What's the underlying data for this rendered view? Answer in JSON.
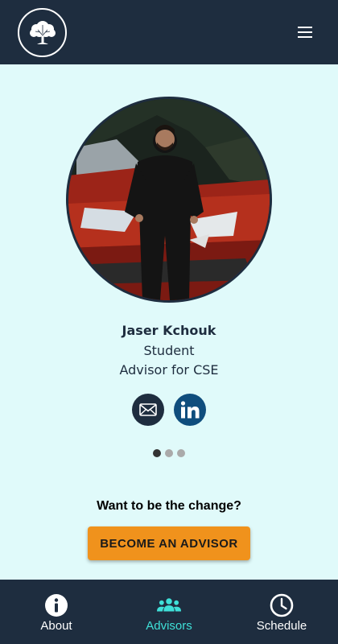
{
  "header": {
    "logo_icon": "tree-logo-icon",
    "menu_icon": "hamburger-menu-icon"
  },
  "advisor": {
    "name": "Jaser Kchouk",
    "role_line1": "Student",
    "role_line2": "Advisor for CSE",
    "social": [
      {
        "icon": "mail-icon"
      },
      {
        "icon": "linkedin-icon"
      }
    ]
  },
  "carousel": {
    "total": 3,
    "active_index": 0
  },
  "cta": {
    "title": "Want to be the change?",
    "button_label": "BECOME AN ADVISOR"
  },
  "bottom_nav": {
    "items": [
      {
        "label": "About",
        "icon": "info-icon",
        "active": false
      },
      {
        "label": "Advisors",
        "icon": "people-group-icon",
        "active": true
      },
      {
        "label": "Schedule",
        "icon": "clock-icon",
        "active": false
      }
    ]
  },
  "colors": {
    "header_bg": "#1e2d3f",
    "page_bg": "#e0fafa",
    "accent": "#f0921c",
    "active_nav": "#3fe0d8",
    "inactive_nav": "#ffffff",
    "linkedin": "#0f4d7d",
    "dot_active": "#333333",
    "dot_inactive": "#aaaaaa"
  }
}
